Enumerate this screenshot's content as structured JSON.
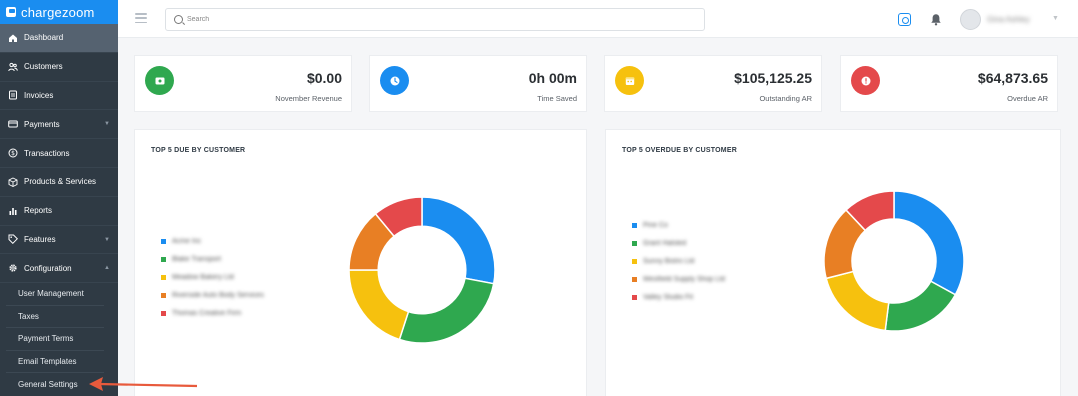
{
  "brand": {
    "name": "chargezoom"
  },
  "sidebar": {
    "items": [
      {
        "label": "Dashboard",
        "icon": "home-icon",
        "active": true
      },
      {
        "label": "Customers",
        "icon": "users-icon"
      },
      {
        "label": "Invoices",
        "icon": "invoice-icon"
      },
      {
        "label": "Payments",
        "icon": "card-icon",
        "chevron": "▼"
      },
      {
        "label": "Transactions",
        "icon": "dollar-icon"
      },
      {
        "label": "Products & Services",
        "icon": "box-icon"
      },
      {
        "label": "Reports",
        "icon": "chart-icon"
      },
      {
        "label": "Features",
        "icon": "tag-icon",
        "chevron": "▼"
      },
      {
        "label": "Configuration",
        "icon": "gear-icon",
        "chevron": "▲"
      }
    ],
    "config_sub_items": [
      {
        "label": "User Management"
      },
      {
        "label": "Taxes"
      },
      {
        "label": "Payment Terms"
      },
      {
        "label": "Email Templates"
      },
      {
        "label": "General Settings"
      }
    ]
  },
  "topbar": {
    "search_placeholder": "Search",
    "user_name": "Gina Ashley"
  },
  "stats": [
    {
      "value": "$0.00",
      "label": "November Revenue",
      "color": "#2fa84f",
      "icon": "wallet-icon"
    },
    {
      "value": "0h 00m",
      "label": "Time Saved",
      "color": "#1a8df0",
      "icon": "clock-icon"
    },
    {
      "value": "$105,125.25",
      "label": "Outstanding AR",
      "color": "#f6c10e",
      "icon": "calendar-icon"
    },
    {
      "value": "$64,873.65",
      "label": "Overdue AR",
      "color": "#e4494b",
      "icon": "alert-icon"
    }
  ],
  "panels": [
    {
      "title": "TOP 5 DUE BY CUSTOMER",
      "legend": [
        "Acme Inc",
        "Blake Transport",
        "Meadow Bakery Ltd",
        "Riverside Auto Body Services",
        "Thomas Creative Firm"
      ]
    },
    {
      "title": "TOP 5 OVERDUE BY CUSTOMER",
      "legend": [
        "Pine Co",
        "Grant Halsted",
        "Sunny Bistro Ltd",
        "Westfield Supply Shop Ltd",
        "Valley Studio Fit"
      ]
    }
  ],
  "chart_data": [
    {
      "type": "pie",
      "title": "TOP 5 DUE BY CUSTOMER",
      "donut": true,
      "categories": [
        "Acme Inc",
        "Blake Transport",
        "Meadow Bakery Ltd",
        "Riverside Auto Body Services",
        "Thomas Creative Firm"
      ],
      "values": [
        28,
        27,
        20,
        14,
        11
      ],
      "colors": [
        "#1a8df0",
        "#2fa84f",
        "#f6c10e",
        "#e87f24",
        "#e4494b"
      ]
    },
    {
      "type": "pie",
      "title": "TOP 5 OVERDUE BY CUSTOMER",
      "donut": true,
      "categories": [
        "Pine Co",
        "Grant Halsted",
        "Sunny Bistro Ltd",
        "Westfield Supply Shop Ltd",
        "Valley Studio Fit"
      ],
      "values": [
        33,
        19,
        19,
        17,
        12
      ],
      "colors": [
        "#1a8df0",
        "#2fa84f",
        "#f6c10e",
        "#e87f24",
        "#e4494b"
      ]
    }
  ]
}
